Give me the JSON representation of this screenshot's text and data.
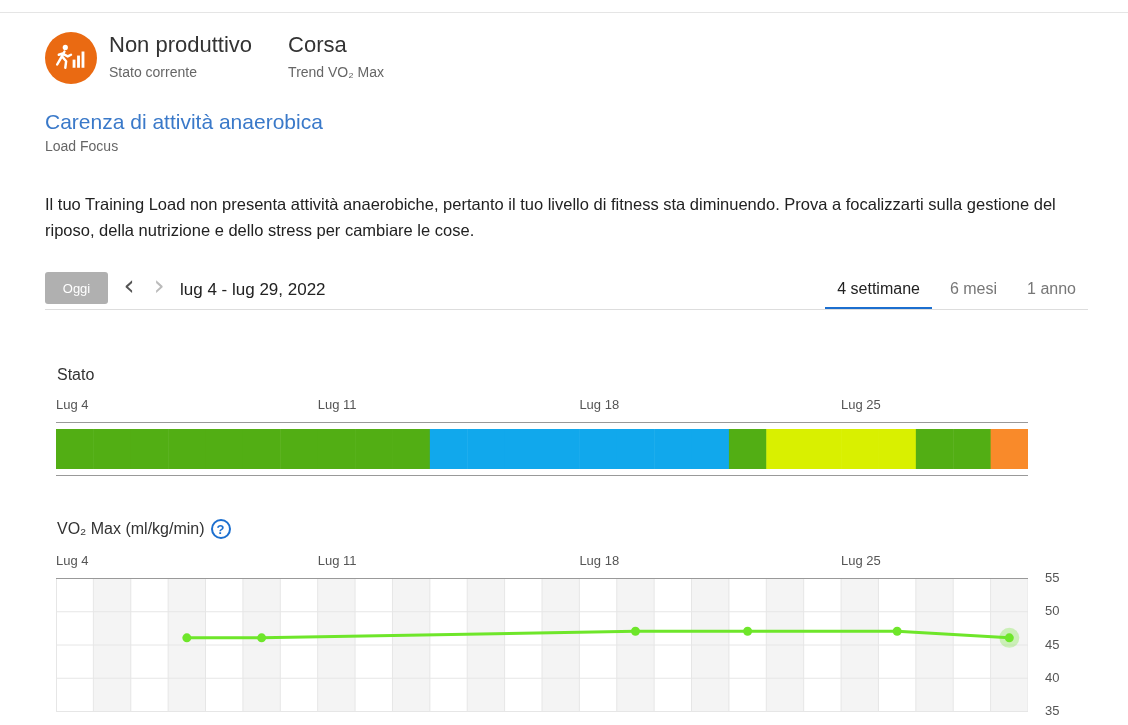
{
  "status": {
    "value": "Non produttivo",
    "label": "Stato corrente"
  },
  "trend": {
    "value": "Corsa",
    "label": "Trend VO₂ Max"
  },
  "focus": {
    "title": "Carenza di attività anaerobica",
    "label": "Load Focus"
  },
  "description": "Il tuo Training Load non presenta attività anaerobiche, pertanto il tuo livello di fitness sta diminuendo. Prova a focalizzarti sulla gestione del riposo, della nutrizione e dello stress per cambiare le cose.",
  "toolbar": {
    "today": "Oggi",
    "prev": "‹",
    "next": "›",
    "range": "lug 4 - lug 29, 2022"
  },
  "tabs": [
    {
      "label": "4 settimane",
      "selected": true
    },
    {
      "label": "6 mesi",
      "selected": false
    },
    {
      "label": "1 anno",
      "selected": false
    }
  ],
  "state_strip": {
    "title": "Stato",
    "ticks": [
      "Lug 4",
      "Lug 11",
      "Lug 18",
      "Lug 25"
    ],
    "days": [
      {
        "color": "#52ae14"
      },
      {
        "color": "#52ae14"
      },
      {
        "color": "#52ae14"
      },
      {
        "color": "#52ae14"
      },
      {
        "color": "#52ae14"
      },
      {
        "color": "#52ae14"
      },
      {
        "color": "#52ae14"
      },
      {
        "color": "#52ae14"
      },
      {
        "color": "#52ae14"
      },
      {
        "color": "#52ae14"
      },
      {
        "color": "#11a8ec"
      },
      {
        "color": "#11a8ec"
      },
      {
        "color": "#11a8ec"
      },
      {
        "color": "#11a8ec"
      },
      {
        "color": "#11a8ec"
      },
      {
        "color": "#11a8ec"
      },
      {
        "color": "#11a8ec"
      },
      {
        "color": "#11a8ec"
      },
      {
        "color": "#52ae14"
      },
      {
        "color": "#d9f000"
      },
      {
        "color": "#d9f000"
      },
      {
        "color": "#d9f000"
      },
      {
        "color": "#d9f000"
      },
      {
        "color": "#52ae14"
      },
      {
        "color": "#52ae14"
      },
      {
        "color": "#f98a2a"
      }
    ]
  },
  "vo2": {
    "title": "VO₂ Max (ml/kg/min)",
    "help": "?",
    "chart_data": {
      "type": "line",
      "categories": [
        "Lug 4",
        null,
        null,
        null,
        null,
        null,
        null,
        "Lug 11",
        null,
        null,
        null,
        null,
        null,
        null,
        "Lug 18",
        null,
        null,
        null,
        null,
        null,
        null,
        "Lug 25",
        null,
        null,
        null,
        null
      ],
      "grid": true,
      "series": [
        {
          "color": "#6ee62a",
          "marker": true,
          "values": [
            null,
            null,
            null,
            46,
            null,
            46,
            null,
            null,
            null,
            null,
            null,
            null,
            null,
            null,
            null,
            47,
            null,
            null,
            47,
            null,
            null,
            null,
            47,
            null,
            null,
            46
          ]
        }
      ],
      "ylim": [
        35,
        55
      ],
      "yticks": [
        35,
        40,
        45,
        50,
        55
      ]
    }
  }
}
